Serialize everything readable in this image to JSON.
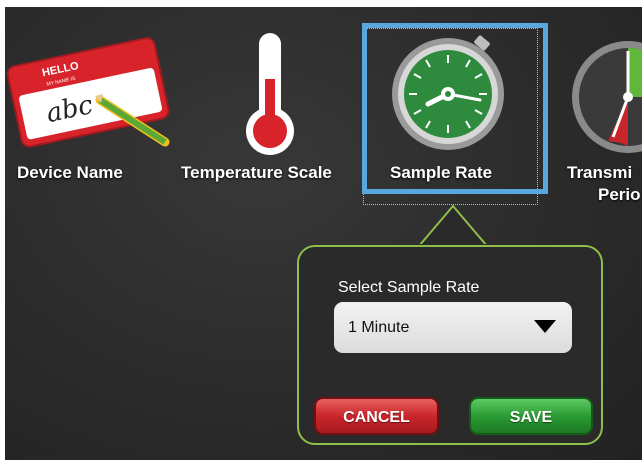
{
  "tiles": [
    {
      "label": "Device Name",
      "icon": "name-tag-icon"
    },
    {
      "label": "Temperature Scale",
      "icon": "thermometer-icon"
    },
    {
      "label": "Sample Rate",
      "icon": "stopwatch-icon"
    },
    {
      "label_line1": "Transmi",
      "label_line2": "Perio",
      "icon": "transmission-period-icon"
    }
  ],
  "name_tag": {
    "hello": "HELLO",
    "sub": "MY NAME IS",
    "handwriting": "abc"
  },
  "popup": {
    "title": "Select Sample Rate",
    "selected_value": "1 Minute",
    "cancel_label": "CANCEL",
    "save_label": "SAVE"
  },
  "colors": {
    "accent_selection": "#5aa7e0",
    "popup_border": "#8fbf4a",
    "cancel": "#c9262b",
    "save": "#2a9b34"
  }
}
